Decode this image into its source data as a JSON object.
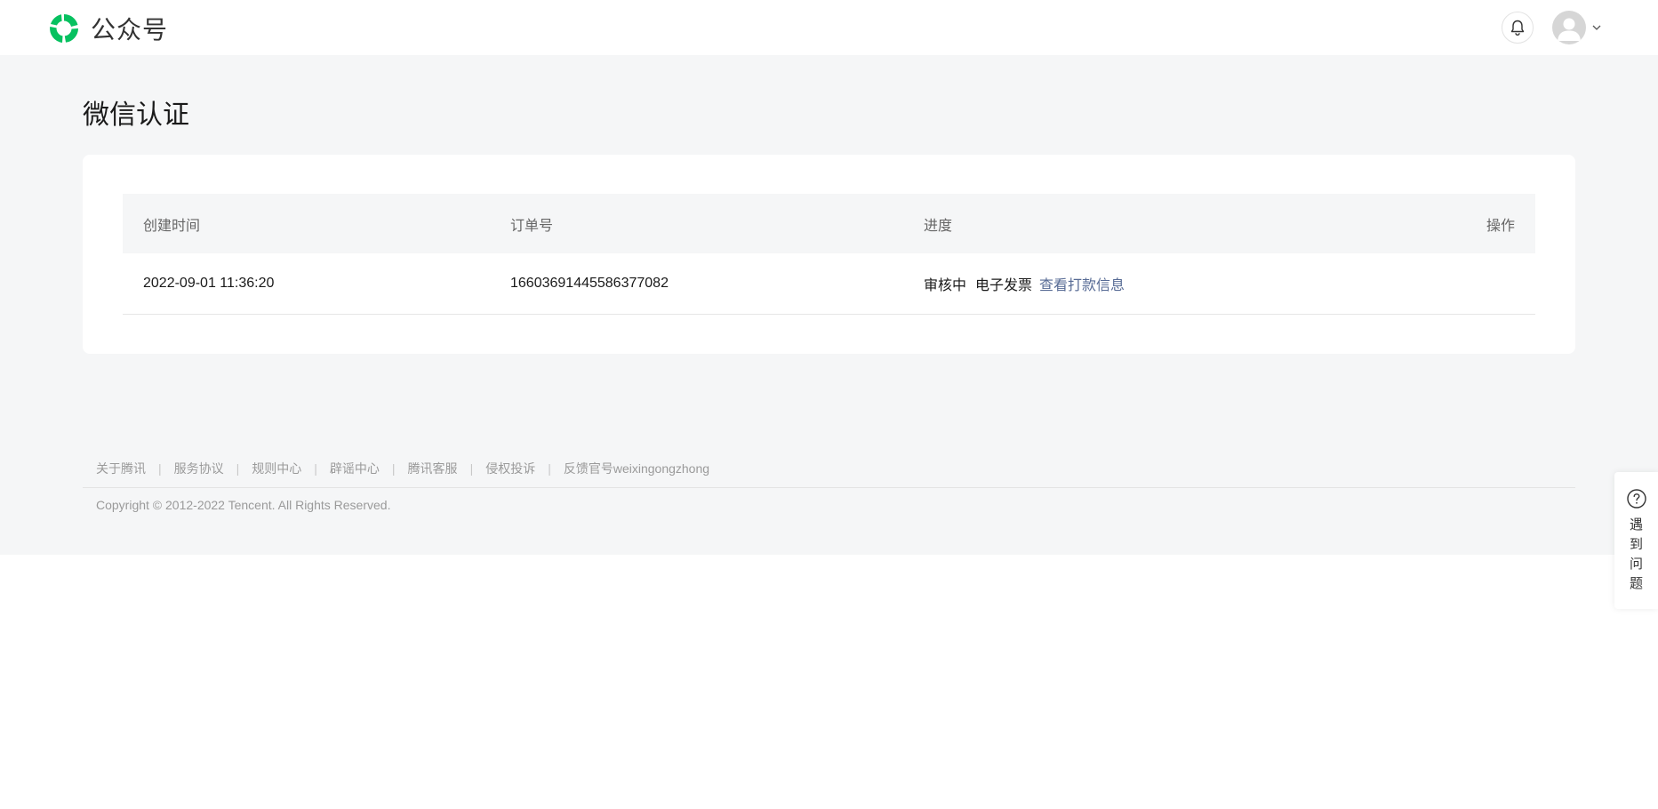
{
  "header": {
    "brand_name": "公众号",
    "brand_color": "#07c160"
  },
  "page": {
    "title": "微信认证"
  },
  "table": {
    "columns": [
      "创建时间",
      "订单号",
      "进度",
      "操作"
    ],
    "rows": [
      {
        "created_time": "2022-09-01 11:36:20",
        "order_no": "1660369144558637 7082",
        "status": "审核中",
        "invoice": "电子发票",
        "link": "查看打款信息"
      }
    ]
  },
  "footer": {
    "links": [
      "关于腾讯",
      "服务协议",
      "规则中心",
      "辟谣中心",
      "腾讯客服",
      "侵权投诉",
      "反馈官号weixingongzhong"
    ],
    "copyright": "Copyright © 2012-2022 Tencent. All Rights Reserved."
  },
  "help": {
    "label": "遇到问题"
  },
  "icons": {
    "logo": "wechat-official-account-logo",
    "bell": "bell-icon",
    "avatar": "avatar",
    "dropdown": "chevron-down-icon",
    "help": "question-circle-icon"
  },
  "colors": {
    "link": "#576b95",
    "page_bg": "#f5f6f7"
  }
}
